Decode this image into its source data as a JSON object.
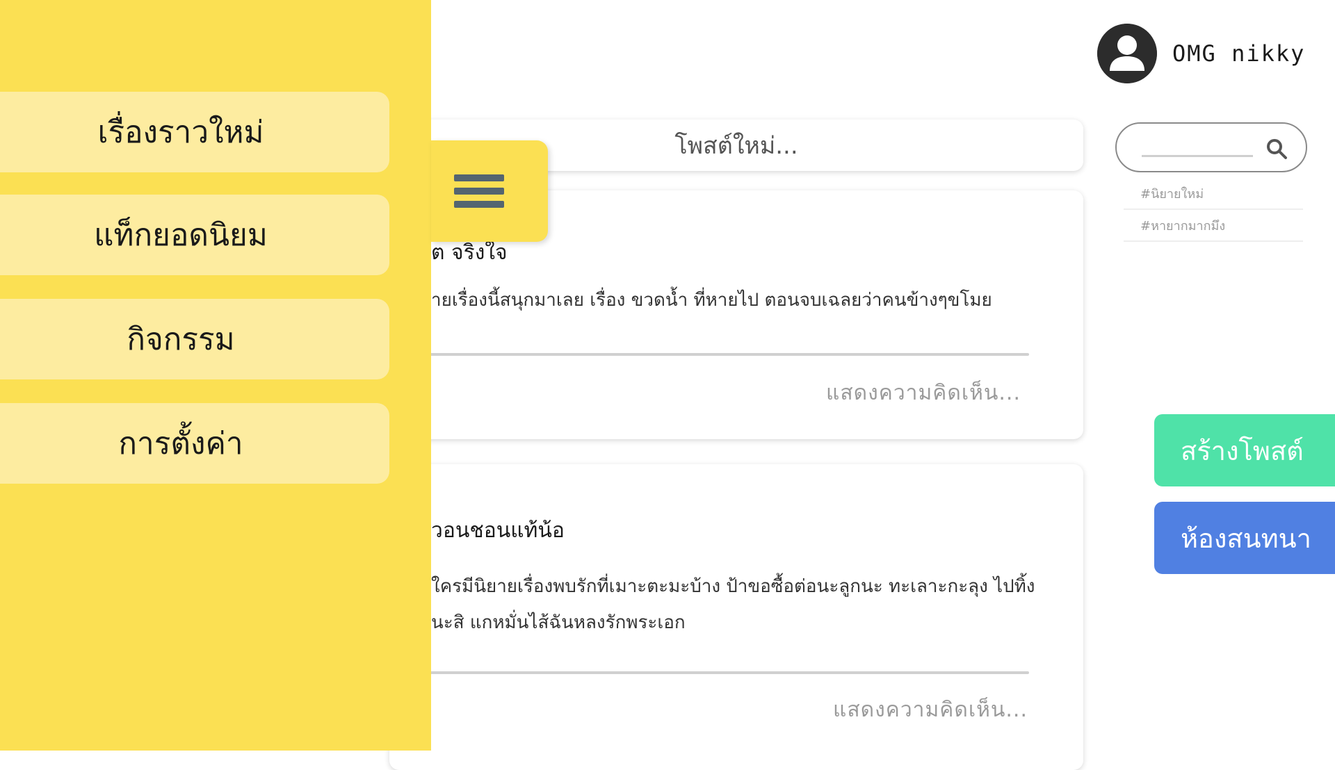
{
  "sidebar": {
    "items": [
      {
        "label": "เรื่องราวใหม่"
      },
      {
        "label": "แท็กยอดนิยม"
      },
      {
        "label": "กิจกรรม"
      },
      {
        "label": "การตั้งค่า"
      }
    ],
    "menu_icon": "hamburger-menu-icon"
  },
  "profile": {
    "username": "OMG nikky",
    "avatar_icon": "user-avatar-icon"
  },
  "composer": {
    "placeholder": "โพสต์ใหม่..."
  },
  "posts": [
    {
      "title": "ต จริงใจ",
      "body": "ายเรื่องนี้สนุกมาเลย เรื่อง ขวดน้ำ ที่หายไป ตอนจบเฉลยว่าคนข้างๆขโมย",
      "comment_placeholder": "แสดงความคิดเห็น..."
    },
    {
      "title": "วอนชอนแท้น้อ",
      "body": "ใครมีนิยายเรื่องพบรักที่เมาะตะมะบ้าง ป้าขอซื้อต่อนะลูกนะ ทะเลาะกะลุง ไปทิ้งนะสิ แกหมั่นไส้ฉันหลงรักพระเอก",
      "comment_placeholder": "แสดงความคิดเห็น..."
    }
  ],
  "search": {
    "placeholder": "",
    "icon": "search-icon"
  },
  "tags": [
    "#นิยายใหม่",
    "#หายากมากมึง"
  ],
  "actions": {
    "create_post": "สร้างโพสต์",
    "chat_room": "ห้องสนทนา"
  },
  "colors": {
    "sidebar": "#fbe053",
    "menu_item": "#fdeca0",
    "create_post": "#4fe2a8",
    "chat_room": "#5080e2",
    "hamburger_bars": "#546570"
  }
}
